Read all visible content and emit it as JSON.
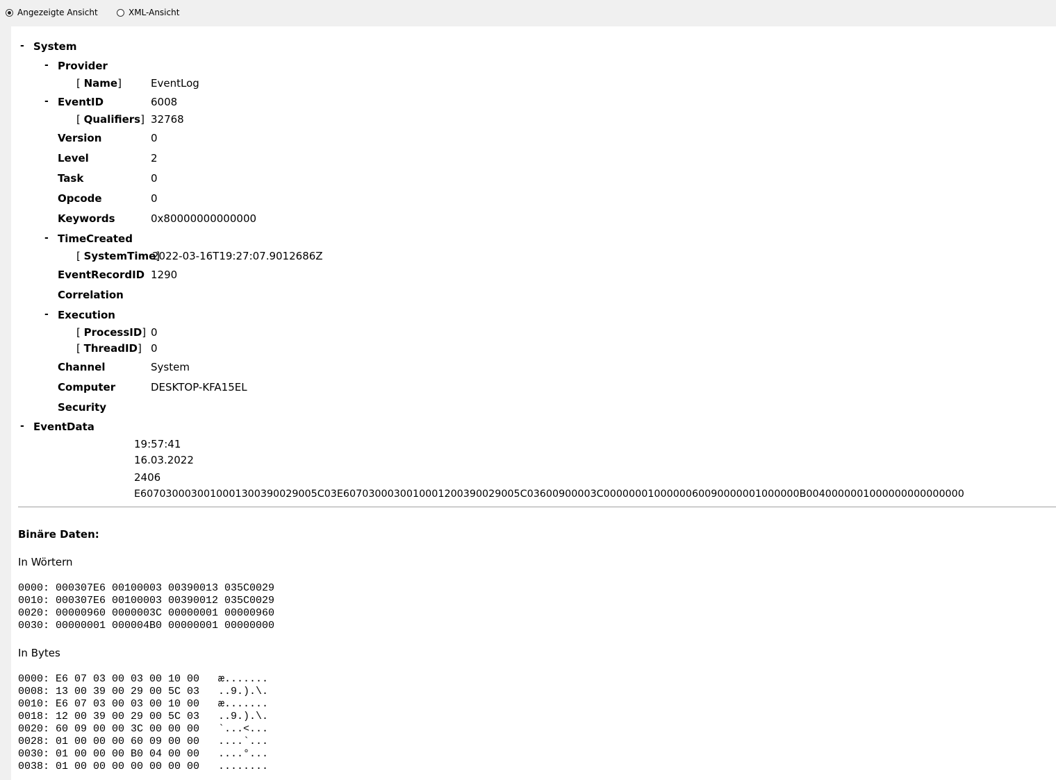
{
  "view_options": {
    "display": "Angezeigte Ansicht",
    "xml": "XML-Ansicht",
    "selected": "display"
  },
  "tree": {
    "toggle": "-",
    "system": "System",
    "provider": "Provider",
    "name_key": "Name",
    "name_val": "EventLog",
    "eventid_key": "EventID",
    "eventid_val": "6008",
    "qualifiers_key": "Qualifiers",
    "qualifiers_val": "32768",
    "version_key": "Version",
    "version_val": "0",
    "level_key": "Level",
    "level_val": "2",
    "task_key": "Task",
    "task_val": "0",
    "opcode_key": "Opcode",
    "opcode_val": "0",
    "keywords_key": "Keywords",
    "keywords_val": "0x80000000000000",
    "timecreated_key": "TimeCreated",
    "systemtime_key": "SystemTime",
    "systemtime_val": "2022-03-16T19:27:07.9012686Z",
    "eventrecordid_key": "EventRecordID",
    "eventrecordid_val": "1290",
    "correlation_key": "Correlation",
    "execution_key": "Execution",
    "processid_key": "ProcessID",
    "processid_val": "0",
    "threadid_key": "ThreadID",
    "threadid_val": "0",
    "channel_key": "Channel",
    "channel_val": "System",
    "computer_key": "Computer",
    "computer_val": "DESKTOP-KFA15EL",
    "security_key": "Security",
    "eventdata": "EventData",
    "eventdata_values": [
      "19:57:41",
      "16.03.2022",
      "2406",
      "E607030003001000130039002900 5C03E607030003001000120039002900 5C03600900003C00000001000000600900000 01000000B0040000001000000000000000"
    ]
  },
  "binary": {
    "heading": "Binäre Daten:",
    "words_label": "In Wörtern",
    "words_dump": "0000: 000307E6 00100003 00390013 035C0029\n0010: 000307E6 00100003 00390012 035C0029\n0020: 00000960 0000003C 00000001 00000960\n0030: 00000001 000004B0 00000001 00000000",
    "bytes_label": "In Bytes",
    "bytes_dump": "0000: E6 07 03 00 03 00 10 00   æ.......\n0008: 13 00 39 00 29 00 5C 03   ..9.).\\.\n0010: E6 07 03 00 03 00 10 00   æ.......\n0018: 12 00 39 00 29 00 5C 03   ..9.).\\.\n0020: 60 09 00 00 3C 00 00 00   `...<...\n0028: 01 00 00 00 60 09 00 00   ....`...\n0030: 01 00 00 00 B0 04 00 00   ....°...\n0038: 01 00 00 00 00 00 00 00   ........"
  }
}
